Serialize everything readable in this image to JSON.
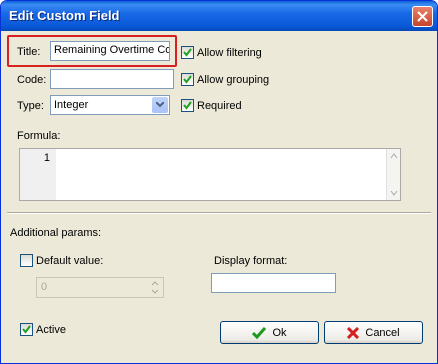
{
  "window": {
    "title": "Edit Custom Field"
  },
  "fields": {
    "title_label": "Title:",
    "title_value": "Remaining Overtime Co",
    "code_label": "Code:",
    "code_value": "",
    "type_label": "Type:",
    "type_value": "Integer",
    "formula_label": "Formula:",
    "formula_line_number": "1"
  },
  "options": {
    "allow_filtering": {
      "label": "Allow filtering",
      "checked": true
    },
    "allow_grouping": {
      "label": "Allow grouping",
      "checked": true
    },
    "required": {
      "label": "Required",
      "checked": true
    }
  },
  "additional": {
    "section_label": "Additional params:",
    "default_value_label": "Default value:",
    "default_value_checked": false,
    "default_value": "0",
    "display_format_label": "Display format:",
    "display_format_value": ""
  },
  "footer": {
    "active_label": "Active",
    "active_checked": true,
    "ok_label": "Ok",
    "cancel_label": "Cancel"
  },
  "colors": {
    "titlebar": "#0858d7",
    "highlight": "#d92020",
    "ok_icon": "#1c9a1c",
    "cancel_icon": "#d42020"
  },
  "icons": [
    "close-icon",
    "check-icon",
    "dropdown-arrow-icon",
    "ok-check-icon",
    "cancel-x-icon"
  ]
}
